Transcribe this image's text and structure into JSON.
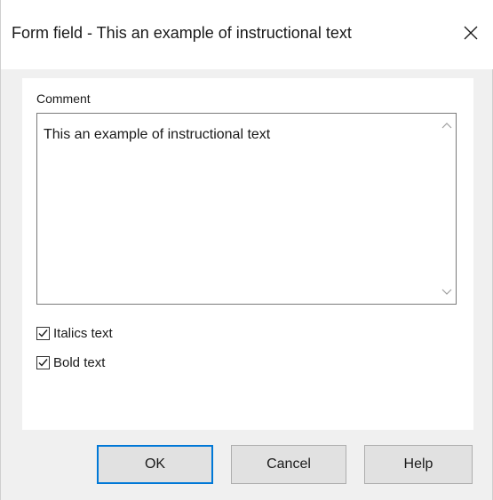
{
  "window": {
    "title": "Form field - This an example of instructional text",
    "close_icon": "close-icon"
  },
  "form": {
    "comment_label": "Comment",
    "comment_value": "This an example of instructional text",
    "checkboxes": [
      {
        "label": "Italics text",
        "checked": true
      },
      {
        "label": "Bold text",
        "checked": true
      }
    ]
  },
  "buttons": {
    "ok_label": "OK",
    "cancel_label": "Cancel",
    "help_label": "Help"
  },
  "colors": {
    "default_button_border": "#0078d7",
    "dialog_background": "#f0f0f0"
  }
}
